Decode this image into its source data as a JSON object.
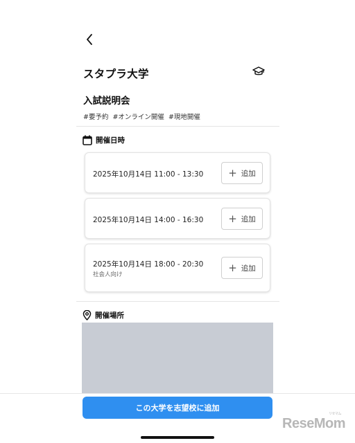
{
  "header": {
    "back_icon": "chevron-left-icon",
    "university_name": "スタプラ大学",
    "favorite_icon": "graduation-cap-icon"
  },
  "event": {
    "title": "入試説明会",
    "tags": [
      "#要予約",
      "#オンライン開催",
      "#現地開催"
    ]
  },
  "schedule": {
    "heading": "開催日時",
    "icon": "calendar-icon",
    "slots": [
      {
        "datetime": "2025年10月14日 11:00 - 13:30",
        "note": "",
        "add_label": "追加"
      },
      {
        "datetime": "2025年10月14日 14:00 - 16:30",
        "note": "",
        "add_label": "追加"
      },
      {
        "datetime": "2025年10月14日 18:00 - 20:30",
        "note": "社会人向け",
        "add_label": "追加"
      }
    ]
  },
  "venue": {
    "heading": "開催場所",
    "icon": "map-pin-icon",
    "map_color": "#c8ccd4"
  },
  "footer": {
    "cta_label": "この大学を志望校に追加",
    "cta_color": "#2f8ff0"
  },
  "watermark": {
    "text": "ReseMom",
    "ruby": "リセマム"
  }
}
